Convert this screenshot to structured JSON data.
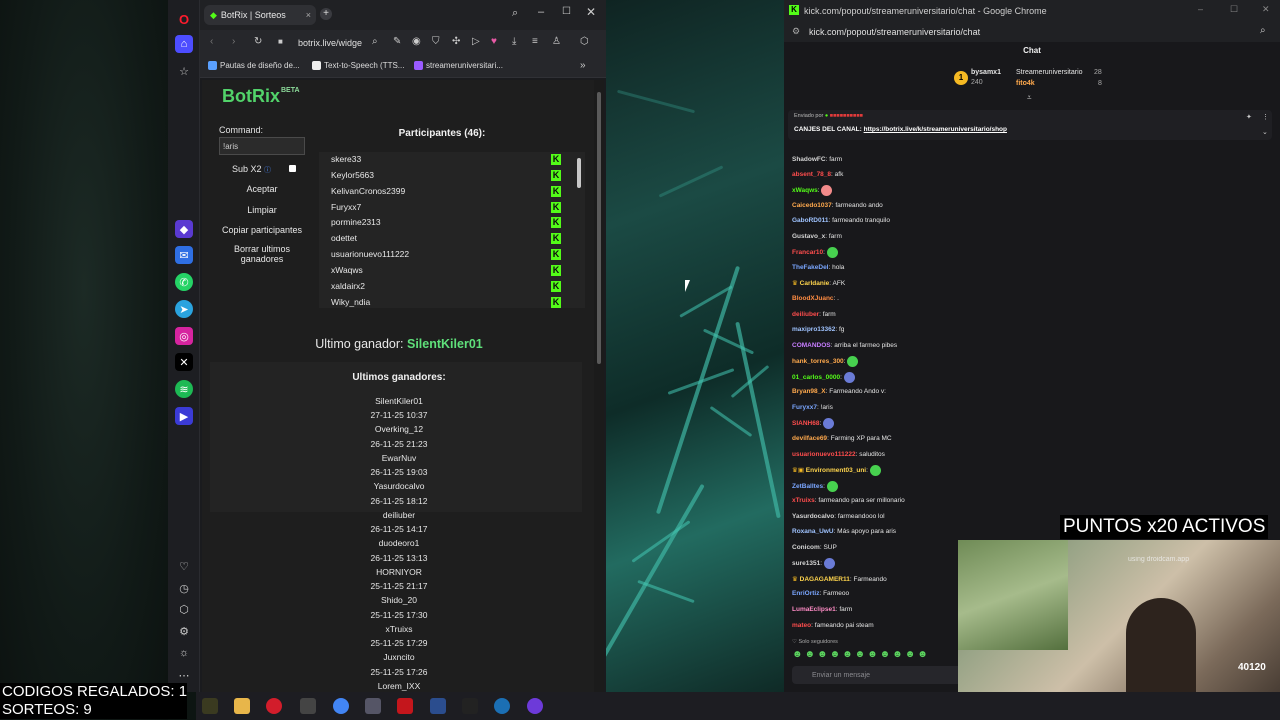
{
  "opera": {
    "tab_title": "BotRix | Sorteos",
    "url": "botrix.live/widge",
    "bookmarks": [
      "Pautas de diseño de...",
      "Text-to-Speech (TTS...",
      "streameruniversitari..."
    ]
  },
  "botrix": {
    "logo": "BotRix",
    "logo_beta": "BETA",
    "command_label": "Command:",
    "command_value": "!aris",
    "sub_label": "Sub X2",
    "buttons": [
      "Aceptar",
      "Limpiar",
      "Copiar participantes",
      "Borrar ultimos ganadores"
    ],
    "participants_title": "Participantes (46):",
    "participants": [
      "skere33",
      "Keylor5663",
      "KelivanCronos2399",
      "Furyxx7",
      "pormine2313",
      "odettet",
      "usuarionuevo111222",
      "xWaqws",
      "xaldairx2",
      "Wiky_ndia"
    ],
    "last_winner_label": "Ultimo ganador:",
    "last_winner": "SilentKiler01",
    "winners_title": "Ultimos ganadores:",
    "winners": [
      {
        "name": "SilentKiler01",
        "date": "27-11-25 10:37"
      },
      {
        "name": "Overking_12",
        "date": "26-11-25 21:23"
      },
      {
        "name": "EwarNuv",
        "date": "26-11-25 19:03"
      },
      {
        "name": "Yasurdocalvo",
        "date": "26-11-25 18:12"
      },
      {
        "name": "deiliuber",
        "date": "26-11-25 14:17"
      },
      {
        "name": "duodeoro1",
        "date": "26-11-25 13:13"
      },
      {
        "name": "HORNIYOR",
        "date": "25-11-25 21:17"
      },
      {
        "name": "Shido_20",
        "date": "25-11-25 17:30"
      },
      {
        "name": "xTruixs",
        "date": "25-11-25 17:29"
      },
      {
        "name": "Juxncito",
        "date": "25-11-25 17:26"
      },
      {
        "name": "Lorem_IXX",
        "date": ""
      }
    ]
  },
  "chrome": {
    "title": "kick.com/popout/streameruniversitario/chat - Google Chrome",
    "url": "kick.com/popout/streameruniversitario/chat",
    "chat_header": "Chat",
    "leaderboard": [
      {
        "name": "bysamx1",
        "value": "240"
      },
      {
        "name": "Streameruniversitario",
        "value": "28"
      },
      {
        "name": "fito4k",
        "value": "8"
      }
    ],
    "pinned_prefix": "Enviado por",
    "pinned_text": "CANJES DEL CANAL:",
    "pinned_link": "https://botrix.live/k/streameruniversitario/shop",
    "messages": [
      {
        "user": "ShadowFC",
        "text": "farm",
        "color": "#d4d4d4"
      },
      {
        "user": "absent_78_8",
        "text": "afk",
        "color": "#ff4d4d"
      },
      {
        "user": "xWaqws",
        "text": "",
        "color": "#53fc18"
      },
      {
        "user": "Caicedo1037",
        "text": "farmeando ando",
        "color": "#ffa94d"
      },
      {
        "user": "GaboRD011",
        "text": "farmeando tranquilo",
        "color": "#9fc3ff"
      },
      {
        "user": "Gustavo_x",
        "text": "farm",
        "color": "#d4d4d4"
      },
      {
        "user": "Francar10",
        "text": "",
        "color": "#ff4d4d"
      },
      {
        "user": "TheFakeDel",
        "text": "hola",
        "color": "#7aa6ff"
      },
      {
        "user": "Carldanie",
        "text": "AFK",
        "color": "#ffd54d"
      },
      {
        "user": "BloodXJuanc",
        "text": ".",
        "color": "#ff8c42"
      },
      {
        "user": "deiliuber",
        "text": "farm",
        "color": "#ff4d4d"
      },
      {
        "user": "maxipro13362",
        "text": "fg",
        "color": "#9fc3ff"
      },
      {
        "user": "COMANDOS",
        "text": "arriba el farmeo pibes",
        "color": "#c77dff"
      },
      {
        "user": "hank_torres_300",
        "text": "",
        "color": "#ffa94d"
      },
      {
        "user": "01_carlos_0000",
        "text": "",
        "color": "#53fc18"
      },
      {
        "user": "Bryan98_X",
        "text": "Farmeando Ando v:",
        "color": "#ffa94d"
      },
      {
        "user": "Furyxx7",
        "text": "!aris",
        "color": "#7aa6ff"
      },
      {
        "user": "SIANH68",
        "text": "",
        "color": "#ff4d4d"
      },
      {
        "user": "devilface69",
        "text": "Farming XP para MC",
        "color": "#ffa94d"
      },
      {
        "user": "usuarionuevo111222",
        "text": "saluditos",
        "color": "#ff4d4d"
      },
      {
        "user": "Environment03_uni",
        "text": "",
        "color": "#ffd54d"
      },
      {
        "user": "ZetBalltes",
        "text": "",
        "color": "#7aa6ff"
      },
      {
        "user": "xTruixs",
        "text": "farmeando para ser millonario",
        "color": "#ff4d4d"
      },
      {
        "user": "Yasurdocalvo",
        "text": "farmeandooo lol",
        "color": "#d4d4d4"
      },
      {
        "user": "Roxana_UwU",
        "text": "Más apoyo para aris",
        "color": "#9fc3ff"
      },
      {
        "user": "Conicom",
        "text": "SUP",
        "color": "#d4d4d4"
      },
      {
        "user": "sure1351",
        "text": "",
        "color": "#d4d4d4"
      },
      {
        "user": "DAGAGAMER11",
        "text": "Farmeando",
        "color": "#ffd54d"
      },
      {
        "user": "EnriOrtiz",
        "text": "Farmeoo",
        "color": "#7aa6ff"
      },
      {
        "user": "LumaEclipse1",
        "text": "farm",
        "color": "#ff8cc6"
      },
      {
        "user": "mateo",
        "text": "fameando pai steam",
        "color": "#ff4d4d"
      }
    ],
    "followers_only": "Solo seguidores",
    "chat_placeholder": "Enviar un mensaje"
  },
  "overlay": {
    "puntos": "PUNTOS x20 ACTIVOS",
    "codigos": "CODIGOS REGALADOS: 1",
    "sorteos": "SORTEOS: 9",
    "cam_watermark": "using droidcam.app",
    "cam_badge": "40120"
  }
}
